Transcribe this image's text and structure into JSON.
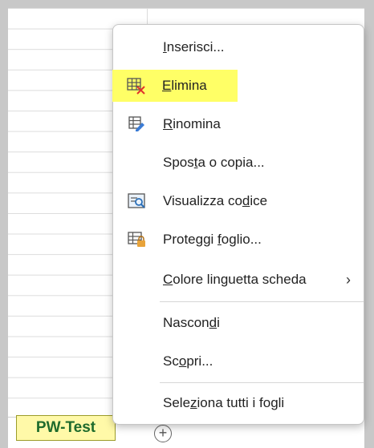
{
  "sheet_tab": {
    "label": "PW-Test"
  },
  "add_sheet": {
    "symbol": "+"
  },
  "menu": {
    "items": [
      {
        "pre": "",
        "ul": "I",
        "post": "nserisci..."
      },
      {
        "pre": "",
        "ul": "E",
        "post": "limina",
        "icon": "delete-sheet-icon"
      },
      {
        "pre": "",
        "ul": "R",
        "post": "inomina",
        "icon": "rename-sheet-icon"
      },
      {
        "pre": "Spos",
        "ul": "t",
        "post": "a o copia..."
      },
      {
        "pre": "Visualizza co",
        "ul": "d",
        "post": "ice",
        "icon": "view-code-icon"
      },
      {
        "pre": "Proteggi ",
        "ul": "f",
        "post": "oglio...",
        "icon": "protect-sheet-icon"
      },
      {
        "pre": "",
        "ul": "C",
        "post": "olore linguetta scheda",
        "submenu": "›"
      },
      {
        "pre": "Nascon",
        "ul": "d",
        "post": "i"
      },
      {
        "pre": "Sc",
        "ul": "o",
        "post": "pri..."
      },
      {
        "pre": "Sele",
        "ul": "z",
        "post": "iona tutti i fogli"
      }
    ]
  },
  "colors": {
    "highlight": "#ffff66",
    "tab_bg": "#fff9a8",
    "tab_text": "#1e6b2c"
  }
}
